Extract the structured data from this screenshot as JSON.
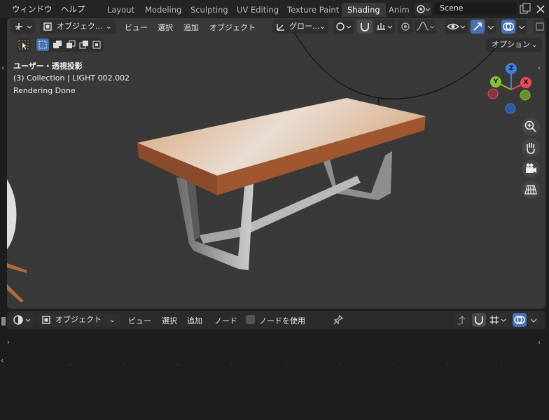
{
  "top_menu": {
    "window": "ウィンドウ",
    "help": "ヘルプ"
  },
  "workspace_tabs": [
    "Layout",
    "Modeling",
    "Sculpting",
    "UV Editing",
    "Texture Paint",
    "Shading",
    "Anim"
  ],
  "active_tab": "Shading",
  "scene": {
    "name": "Scene"
  },
  "viewport": {
    "mode_label": "オブジェク...",
    "menus": {
      "view": "ビュー",
      "select": "選択",
      "add": "追加",
      "object": "オブジェクト"
    },
    "transform_orientation": "グロー...",
    "options_label": "オプション",
    "overlay": {
      "view_name": "ユーザー・透視投影",
      "collection": "(3) Collection | LIGHT 002.002",
      "status": "Rendering Done"
    },
    "gizmo_axes": {
      "z": "Z",
      "y": "Y",
      "x": "X"
    }
  },
  "node_editor": {
    "mode_label": "オブジェクト",
    "menus": {
      "view": "ビュー",
      "select": "選択",
      "add": "追加",
      "node": "ノード"
    },
    "use_nodes_label": "ノードを使用"
  },
  "colors": {
    "accent": "#4772b3",
    "axis_x": "#e74c5b",
    "axis_y": "#8bc034",
    "axis_z": "#3f7fdb"
  }
}
